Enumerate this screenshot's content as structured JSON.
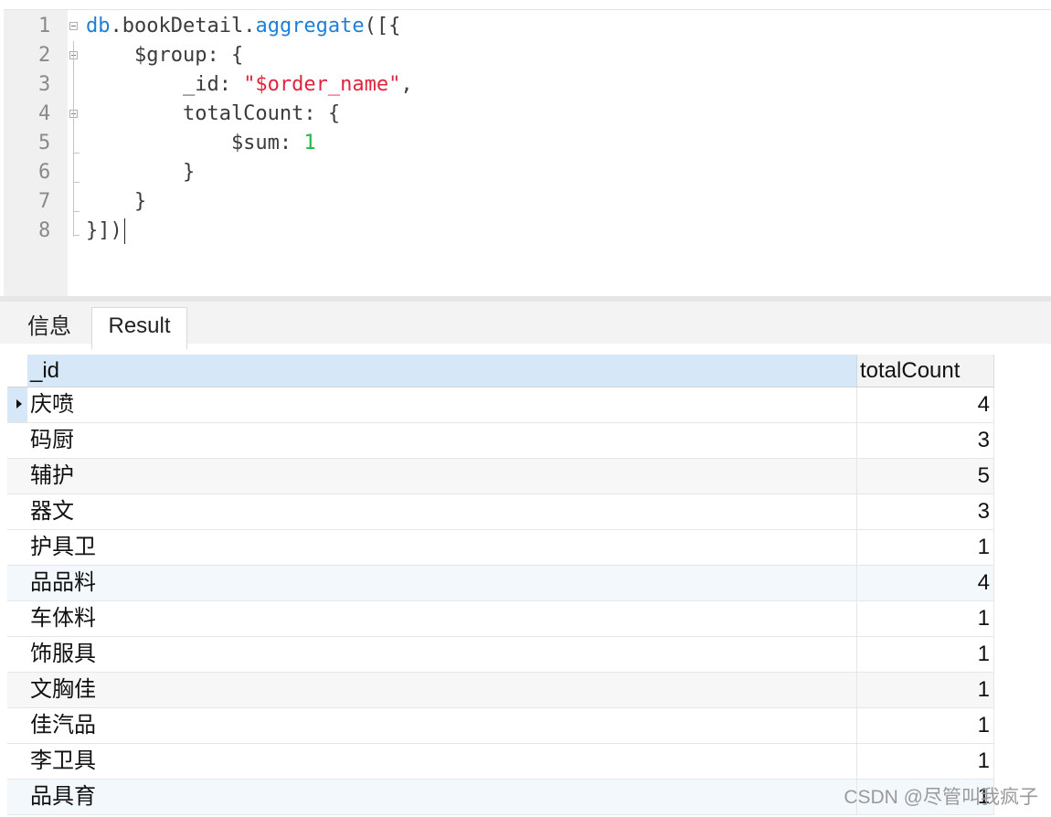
{
  "editor": {
    "lines": [
      {
        "num": "1",
        "tokens": [
          {
            "t": "db",
            "c": "kw-blue"
          },
          {
            "t": ".bookDetail.",
            "c": ""
          },
          {
            "t": "aggregate",
            "c": "kw-blue"
          },
          {
            "t": "([{",
            "c": ""
          }
        ]
      },
      {
        "num": "2",
        "tokens": [
          {
            "t": "    $group: {",
            "c": ""
          }
        ]
      },
      {
        "num": "3",
        "tokens": [
          {
            "t": "        _id: ",
            "c": ""
          },
          {
            "t": "\"$order_name\"",
            "c": "str-red"
          },
          {
            "t": ",",
            "c": ""
          }
        ]
      },
      {
        "num": "4",
        "tokens": [
          {
            "t": "        totalCount: {",
            "c": ""
          }
        ]
      },
      {
        "num": "5",
        "tokens": [
          {
            "t": "            $sum: ",
            "c": ""
          },
          {
            "t": "1",
            "c": "num-green"
          }
        ]
      },
      {
        "num": "6",
        "tokens": [
          {
            "t": "        }",
            "c": ""
          }
        ]
      },
      {
        "num": "7",
        "tokens": [
          {
            "t": "    }",
            "c": ""
          }
        ]
      },
      {
        "num": "8",
        "tokens": [
          {
            "t": "}])",
            "c": ""
          }
        ]
      }
    ]
  },
  "tabs": {
    "info_label": "信息",
    "result_label": "Result"
  },
  "grid": {
    "columns": {
      "id": "_id",
      "count": "totalCount"
    },
    "rows": [
      {
        "id": "庆喷",
        "count": "4"
      },
      {
        "id": "码厨",
        "count": "3"
      },
      {
        "id": "辅护",
        "count": "5"
      },
      {
        "id": "器文",
        "count": "3"
      },
      {
        "id": "护具卫",
        "count": "1"
      },
      {
        "id": "品品料",
        "count": "4"
      },
      {
        "id": "车体料",
        "count": "1"
      },
      {
        "id": "饰服具",
        "count": "1"
      },
      {
        "id": "文胸佳",
        "count": "1"
      },
      {
        "id": "佳汽品",
        "count": "1"
      },
      {
        "id": "李卫具",
        "count": "1"
      },
      {
        "id": "品具育",
        "count": "1"
      }
    ]
  },
  "watermark": "CSDN @尽管叫我疯子"
}
